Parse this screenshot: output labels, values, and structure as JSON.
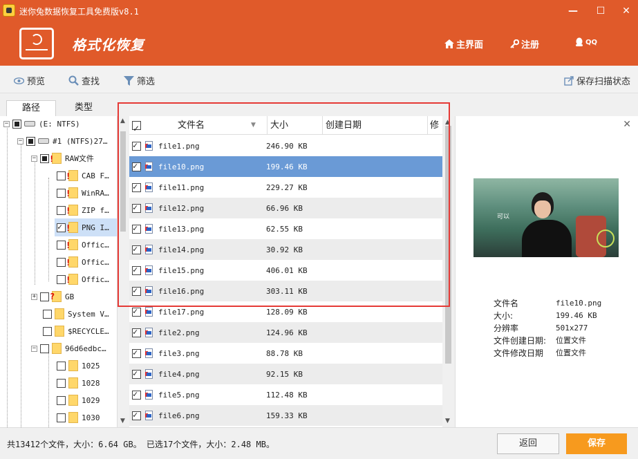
{
  "window": {
    "title": "迷你兔数据恢复工具免费版v8.1",
    "min_label": "—",
    "max_label": "☐",
    "close_label": "✕"
  },
  "header": {
    "title": "格式化恢复",
    "home_label": "主界面",
    "register_label": "注册",
    "qq_label": "QQ"
  },
  "toolbar": {
    "preview_label": "预览",
    "search_label": "查找",
    "filter_label": "筛选",
    "save_scan_label": "保存扫描状态"
  },
  "tabs": {
    "path_label": "路径",
    "type_label": "类型"
  },
  "tree": {
    "items": [
      {
        "label": "(E: NTFS)"
      },
      {
        "label": "#1 (NTFS)27…"
      },
      {
        "label": "RAW文件"
      },
      {
        "label": "CAB F…"
      },
      {
        "label": "WinRA…"
      },
      {
        "label": "ZIP f…"
      },
      {
        "label": "PNG I…"
      },
      {
        "label": "Offic…"
      },
      {
        "label": "Offic…"
      },
      {
        "label": "Offic…"
      },
      {
        "label": "GB"
      },
      {
        "label": "System V…"
      },
      {
        "label": "$RECYCLE…"
      },
      {
        "label": "96d6edbc…"
      },
      {
        "label": "1025"
      },
      {
        "label": "1028"
      },
      {
        "label": "1029"
      },
      {
        "label": "1030"
      }
    ]
  },
  "list": {
    "headers": {
      "name": "文件名",
      "size": "大小",
      "created": "创建日期",
      "modified": "修"
    },
    "rows": [
      {
        "name": "file1.png",
        "size": "246.90 KB"
      },
      {
        "name": "file10.png",
        "size": "199.46 KB"
      },
      {
        "name": "file11.png",
        "size": "229.27 KB"
      },
      {
        "name": "file12.png",
        "size": "66.96 KB"
      },
      {
        "name": "file13.png",
        "size": "62.55 KB"
      },
      {
        "name": "file14.png",
        "size": "30.92 KB"
      },
      {
        "name": "file15.png",
        "size": "406.01 KB"
      },
      {
        "name": "file16.png",
        "size": "303.11 KB"
      },
      {
        "name": "file17.png",
        "size": "128.09 KB"
      },
      {
        "name": "file2.png",
        "size": "124.96 KB"
      },
      {
        "name": "file3.png",
        "size": "88.78 KB"
      },
      {
        "name": "file4.png",
        "size": "92.15 KB"
      },
      {
        "name": "file5.png",
        "size": "112.48 KB"
      },
      {
        "name": "file6.png",
        "size": "159.33 KB"
      }
    ]
  },
  "preview": {
    "close_label": "✕",
    "image_caption": "可以",
    "info": [
      {
        "key": "文件名",
        "value": "file10.png"
      },
      {
        "key": "大小:",
        "value": "199.46 KB"
      },
      {
        "key": "分辨率",
        "value": "501x277"
      },
      {
        "key": "文件创建日期:",
        "value": "位置文件"
      },
      {
        "key": "文件修改日期",
        "value": "位置文件"
      }
    ]
  },
  "status": {
    "text": "共13412个文件，大小：6.64 GB。 已选17个文件，大小：2.48 MB。"
  },
  "buttons": {
    "back_label": "返回",
    "save_label": "保存"
  },
  "colors": {
    "brand": "#e05a2a",
    "selected_row": "#6a9ad6",
    "save_button": "#f79a1e",
    "highlight_box": "#e53935"
  }
}
